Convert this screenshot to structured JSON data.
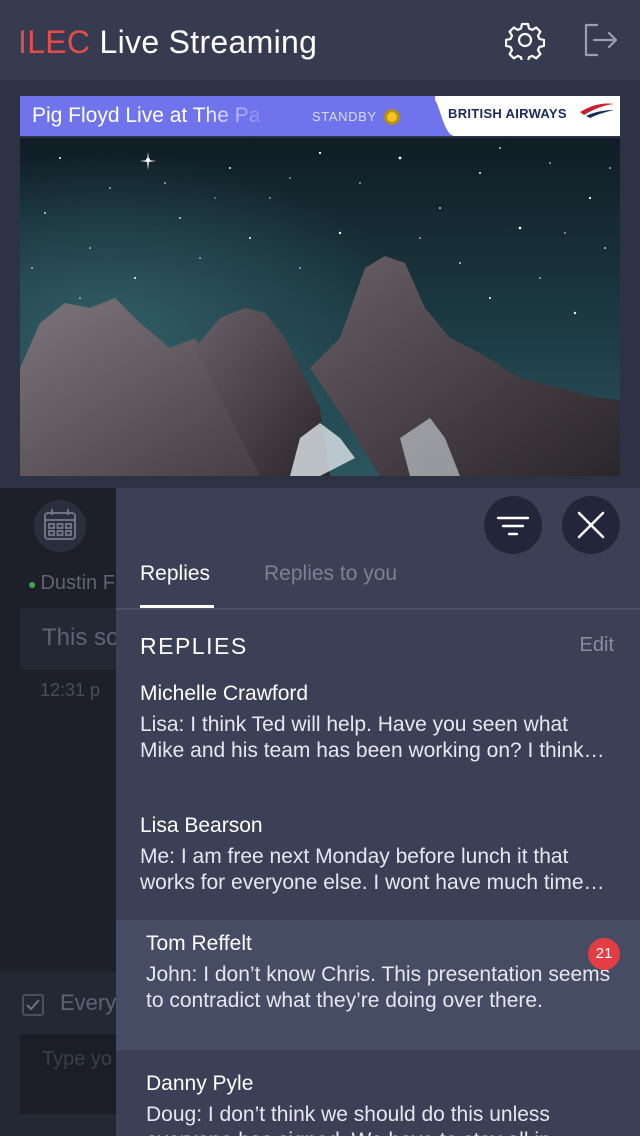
{
  "header": {
    "brand": "ILEC",
    "title_rest": " Live Streaming",
    "icons": {
      "settings": "gear-icon",
      "logout": "logout-icon"
    }
  },
  "player": {
    "stream_title": "Pig Floyd Live at The Pa",
    "status": "STANDBY",
    "sponsor": "BRITISH AIRWAYS"
  },
  "background_chat": {
    "author": "Dustin F",
    "message": "This so",
    "time": "12:31 p",
    "checkbox_label": "Every",
    "input_placeholder": "Type yo"
  },
  "replies_panel": {
    "tabs": [
      {
        "label": "Replies",
        "active": true
      },
      {
        "label": "Replies to you",
        "active": false
      }
    ],
    "section_title": "REPLIES",
    "edit_label": "Edit",
    "items": [
      {
        "name": "Michelle Crawford",
        "preview": "Lisa: I think Ted will help. Have you seen what Mike and his team has been working on? I think they might have something."
      },
      {
        "name": "Lisa Bearson",
        "preview": "Me: I am free next Monday before lunch it that works for everyone else. I wont have much time after that."
      },
      {
        "name": "Tom Reffelt",
        "preview": "John: I don’t know Chris. This presentation seems to contradict what they’re doing over there.",
        "badge": "21"
      },
      {
        "name": "Danny Pyle",
        "preview": "Doug: I don’t think we should do this unless everyone has signed. We have to stay all in."
      }
    ]
  },
  "colors": {
    "accent": "#e44b4b",
    "header_bg": "#363b4f",
    "panel_bg": "#3b4056",
    "banner": "#6f74ec",
    "status": "#f3c21d",
    "badge": "#e43c43"
  }
}
